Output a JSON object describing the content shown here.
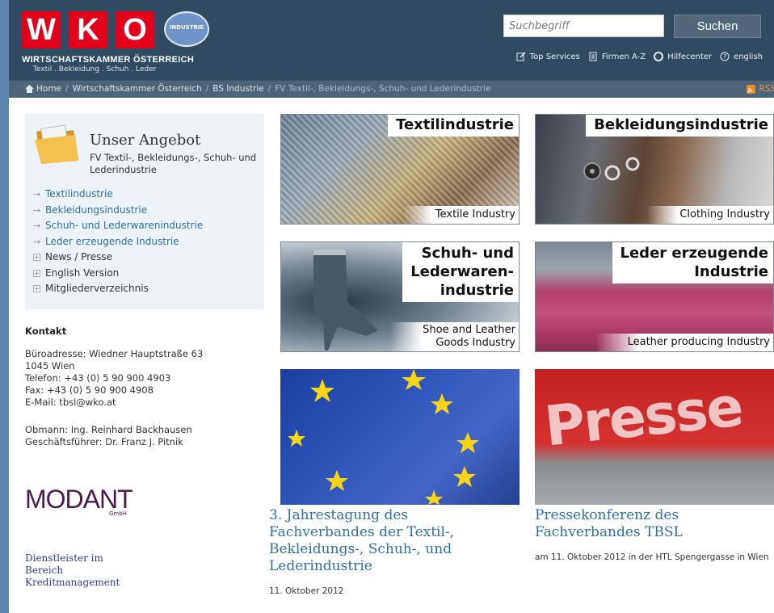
{
  "header": {
    "logo_letters": [
      "W",
      "K",
      "O"
    ],
    "logo_badge": "INDUSTRIE",
    "org_name": "WIRTSCHAFTSKAMMER ÖSTERREICH",
    "org_sub": "Textil . Bekleidung . Schuh . Leder",
    "search": {
      "placeholder": "Suchbegriff",
      "button": "Suchen"
    },
    "service_links": [
      {
        "label": "Top Services",
        "icon": "edit-icon"
      },
      {
        "label": "Firmen A-Z",
        "icon": "document-icon"
      },
      {
        "label": "Hilfecenter",
        "icon": "lifebuoy-icon"
      },
      {
        "label": "english",
        "icon": "help-circle-icon"
      }
    ]
  },
  "breadcrumb": {
    "items": [
      "Home",
      "Wirtschaftskammer Österreich",
      "BS Industrie"
    ],
    "current": "FV Textil-, Bekleidungs-, Schuh- und Lederindustrie",
    "rss": "RSS"
  },
  "sidebar": {
    "title": "Unser Angebot",
    "subtitle": "FV Textil-, Bekleidungs-, Schuh- und Lederindustrie",
    "links": [
      "Textilindustrie",
      "Bekleidungsindustrie",
      "Schuh- und Lederwarenindustrie",
      "Leder erzeugende Industrie"
    ],
    "expandables": [
      "News / Presse",
      "English Version",
      "Mitgliederverzeichnis"
    ]
  },
  "contact": {
    "heading": "Kontakt",
    "address": "Büroadresse: Wiedner Hauptstraße 63",
    "city": "1045 Wien",
    "phone": "Telefon: +43 (0) 5 90 900 4903",
    "fax": "Fax: +43 (0) 5 90 900 4908",
    "email": "E-Mail: tbsl@wko.at",
    "chairman": "Obmann: Ing. Reinhard Backhausen",
    "manager": "Geschäftsführer: Dr. Franz J. Pitnik"
  },
  "sponsor": {
    "logo": "MODANT",
    "logo_sub": "GmbH",
    "text_lines": [
      "Dienstleister im",
      "Bereich",
      "Kreditmanagement"
    ]
  },
  "tiles": [
    {
      "title": "Textilindustrie",
      "foot": "Textile Industry"
    },
    {
      "title": "Bekleidungsindustrie",
      "foot": "Clothing Industry"
    },
    {
      "title_lines": [
        "Schuh- und",
        "Lederwaren-",
        "industrie"
      ],
      "foot_lines": [
        "Shoe and Leather",
        "Goods Industry"
      ]
    },
    {
      "title_lines": [
        "Leder erzeugende",
        "Industrie"
      ],
      "foot": "Leather producing Industry"
    }
  ],
  "news": [
    {
      "title": "3. Jahrestagung des Fachverbandes der Textil-, Bekleidungs-, Schuh-, und Lederindustrie",
      "date": "11. Oktober 2012"
    },
    {
      "title": "Pressekonferenz des Fachverbandes TBSL",
      "date": "am 11. Oktober 2012 in der HTL Spengergasse in Wien",
      "image_text": "Presse"
    }
  ],
  "colors": {
    "header_bg": "#2f4b63",
    "logo_red": "#e2001a",
    "link_blue": "#2f6fa9",
    "box_bg": "#edf2f7"
  }
}
